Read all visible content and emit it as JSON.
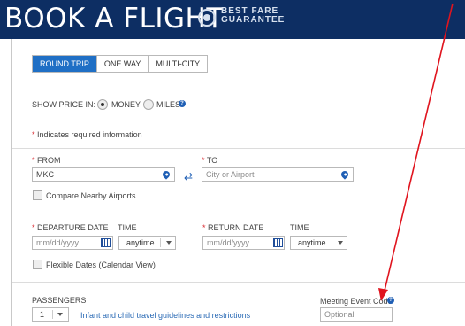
{
  "header": {
    "title": "BOOK A FLIGHT",
    "best_fare_line1": "BEST FARE",
    "best_fare_line2": "GUARANTEE"
  },
  "trip_types": [
    {
      "label": "ROUND TRIP",
      "active": true
    },
    {
      "label": "ONE WAY",
      "active": false
    },
    {
      "label": "MULTI-CITY",
      "active": false
    }
  ],
  "price": {
    "label": "SHOW PRICE IN:",
    "options": [
      {
        "label": "MONEY",
        "selected": true
      },
      {
        "label": "MILES",
        "selected": false
      }
    ]
  },
  "required_note": "Indicates required information",
  "required_marker": "*",
  "from": {
    "label": "FROM",
    "value": "MKC"
  },
  "to": {
    "label": "TO",
    "placeholder": "City or Airport"
  },
  "nearby": {
    "label": "Compare Nearby Airports",
    "checked": false
  },
  "departure": {
    "label": "DEPARTURE DATE",
    "placeholder": "mm/dd/yyyy",
    "time_label": "TIME",
    "time_value": "anytime"
  },
  "return": {
    "label": "RETURN DATE",
    "placeholder": "mm/dd/yyyy",
    "time_label": "TIME",
    "time_value": "anytime"
  },
  "flexible": {
    "label": "Flexible Dates (Calendar View)",
    "checked": false
  },
  "passengers": {
    "label": "PASSENGERS",
    "value": "1",
    "link": "Infant and child travel guidelines and restrictions"
  },
  "meeting": {
    "label": "Meeting Event Code",
    "placeholder": "Optional"
  },
  "colors": {
    "header_bg": "#0d2e63",
    "accent_blue": "#1f6fc5",
    "required_red": "#d8292f",
    "annotation_arrow": "#e0141e"
  }
}
